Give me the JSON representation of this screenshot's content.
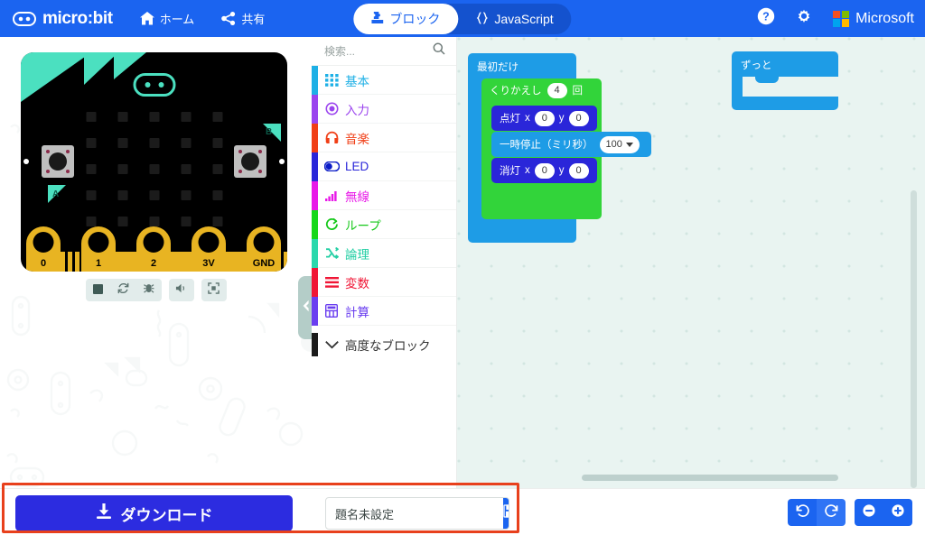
{
  "header": {
    "brand": "micro:bit",
    "brand_icon": "microbit-logo-icon",
    "nav": [
      {
        "label": "ホーム",
        "icon": "home-icon",
        "name": "home"
      },
      {
        "label": "共有",
        "icon": "share-icon",
        "name": "share"
      }
    ],
    "tabs": [
      {
        "label": "ブロック",
        "icon": "puzzle-piece-icon",
        "active": true,
        "name": "blocks"
      },
      {
        "label": "JavaScript",
        "icon": "curly-braces-icon",
        "active": false,
        "name": "javascript"
      }
    ],
    "help_icon": "question-circle-icon",
    "settings_icon": "gear-icon",
    "microsoft_label": "Microsoft",
    "microsoft_icon": "microsoft-logo-icon",
    "bg_color": "#1b64f0"
  },
  "simulator": {
    "board": {
      "pins": [
        "0",
        "1",
        "2",
        "3V",
        "GND"
      ],
      "button_a_label": "A",
      "button_b_label": "B",
      "accent_color": "#4be0c0",
      "pin_color": "#e8b422",
      "body_color": "#000000"
    },
    "controls": [
      {
        "name": "stop-button",
        "icon": "stop-square-icon"
      },
      {
        "name": "restart-button",
        "icon": "refresh-icon"
      },
      {
        "name": "debug-button",
        "icon": "bug-icon"
      },
      {
        "name": "mute-button",
        "icon": "speaker-icon"
      },
      {
        "name": "fullscreen-button",
        "icon": "expand-icon"
      }
    ],
    "collapse_icon": "chevron-left-icon"
  },
  "toolbox": {
    "search_placeholder": "検索...",
    "search_icon": "search-icon",
    "categories": [
      {
        "label": "基本",
        "color": "#1eb0e6",
        "icon": "grid-dots-icon",
        "name": "basic"
      },
      {
        "label": "入力",
        "color": "#9b44ee",
        "icon": "target-dot-icon",
        "name": "input"
      },
      {
        "label": "音楽",
        "color": "#f03e16",
        "icon": "headphones-icon",
        "name": "music"
      },
      {
        "label": "LED",
        "color": "#2a26d9",
        "icon": "toggle-icon",
        "name": "led"
      },
      {
        "label": "無線",
        "color": "#e818e8",
        "icon": "signal-bars-icon",
        "name": "radio"
      },
      {
        "label": "ループ",
        "color": "#16d81a",
        "icon": "loop-arrow-icon",
        "name": "loops"
      },
      {
        "label": "論理",
        "color": "#2ad8ac",
        "icon": "shuffle-icon",
        "name": "logic"
      },
      {
        "label": "変数",
        "color": "#f01636",
        "icon": "lines-icon",
        "name": "variables"
      },
      {
        "label": "計算",
        "color": "#6a3ef0",
        "icon": "calculator-icon",
        "name": "math"
      }
    ],
    "advanced": {
      "label": "高度なブロック",
      "icon": "chevron-down-icon",
      "color": "#1b1b1b",
      "name": "advanced"
    }
  },
  "workspace": {
    "bg_color": "#e9f4f1",
    "blocks": {
      "on_start": {
        "label": "最初だけ",
        "color": "#1e9ce6"
      },
      "forever": {
        "label": "ずっと",
        "color": "#1e9ce6"
      },
      "repeat": {
        "label": "くりかえし",
        "value": "4",
        "suffix": "回",
        "color": "#32d43a"
      },
      "plot": {
        "label": "点灯",
        "x_label": "x",
        "x": "0",
        "y_label": "y",
        "y": "0",
        "color": "#2a26d9"
      },
      "unplot": {
        "label": "消灯",
        "x_label": "x",
        "x": "0",
        "y_label": "y",
        "y": "0",
        "color": "#2a26d9"
      },
      "pause": {
        "label": "一時停止（ミリ秒）",
        "value": "100",
        "color": "#1e9ce6"
      }
    }
  },
  "bottom": {
    "download_label": "ダウンロード",
    "download_icon": "download-icon",
    "download_color": "#2c2ce0",
    "filename_value": "題名未設定",
    "filename_placeholder": "題名未設定",
    "save_icon": "floppy-disk-icon",
    "undo_icon": "undo-arrow-icon",
    "redo_icon": "redo-arrow-icon",
    "zoom_out_icon": "minus-circle-icon",
    "zoom_in_icon": "plus-circle-icon"
  },
  "annotation": {
    "highlight_color": "#e8401c"
  }
}
